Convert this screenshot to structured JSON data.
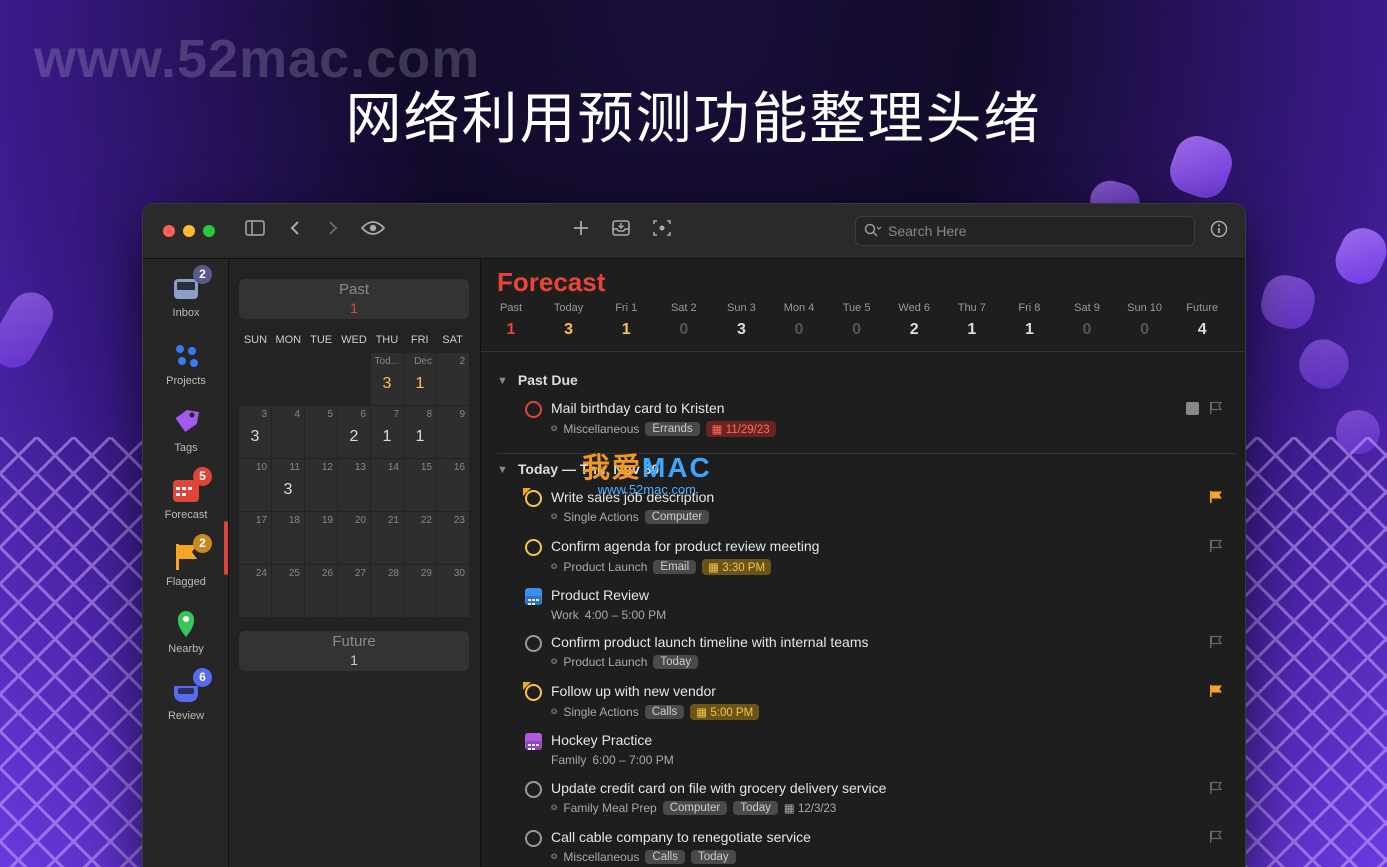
{
  "banner": {
    "watermark": "www.52mac.com",
    "headline": "网络利用预测功能整理头绪"
  },
  "watermark_center": {
    "cn": "我爱",
    "mac": "MAC",
    "url": "www.52mac.com"
  },
  "toolbar": {
    "search_placeholder": "Search Here"
  },
  "sidebar": {
    "items": [
      {
        "label": "Inbox",
        "badge": "2",
        "icon": "inbox-icon",
        "color": "#8aa0c8",
        "badge_color": "#5a5a8a"
      },
      {
        "label": "Projects",
        "badge": "",
        "icon": "projects-icon",
        "color": "#3a7bf5"
      },
      {
        "label": "Tags",
        "badge": "",
        "icon": "tag-icon",
        "color": "#a05af0"
      },
      {
        "label": "Forecast",
        "badge": "5",
        "icon": "forecast-icon",
        "color": "#e0453a",
        "badge_color": "#e0453a"
      },
      {
        "label": "Flagged",
        "badge": "2",
        "icon": "flag-icon",
        "color": "#f6a623",
        "badge_color": "#c88a20"
      },
      {
        "label": "Nearby",
        "badge": "",
        "icon": "location-pin-icon",
        "color": "#35c759"
      },
      {
        "label": "Review",
        "badge": "6",
        "icon": "review-icon",
        "color": "#5a6af0",
        "badge_color": "#5a6af0"
      }
    ]
  },
  "calendar": {
    "past_label": "Past",
    "past_count": "1",
    "future_label": "Future",
    "future_count": "1",
    "weekdays": [
      "SUN",
      "MON",
      "TUE",
      "WED",
      "THU",
      "FRI",
      "SAT"
    ],
    "rows": [
      [
        {
          "d": "",
          "c": ""
        },
        {
          "d": "",
          "c": ""
        },
        {
          "d": "",
          "c": ""
        },
        {
          "d": "",
          "c": ""
        },
        {
          "d": "Tod...",
          "c": "3",
          "hl": true
        },
        {
          "d": "Dec",
          "c": "1",
          "hl": true
        },
        {
          "d": "2",
          "c": ""
        }
      ],
      [
        {
          "d": "3",
          "c": "3"
        },
        {
          "d": "4",
          "c": ""
        },
        {
          "d": "5",
          "c": ""
        },
        {
          "d": "6",
          "c": "2"
        },
        {
          "d": "7",
          "c": "1"
        },
        {
          "d": "8",
          "c": "1"
        },
        {
          "d": "9",
          "c": ""
        }
      ],
      [
        {
          "d": "10",
          "c": ""
        },
        {
          "d": "11",
          "c": "3"
        },
        {
          "d": "12",
          "c": ""
        },
        {
          "d": "13",
          "c": ""
        },
        {
          "d": "14",
          "c": ""
        },
        {
          "d": "15",
          "c": ""
        },
        {
          "d": "16",
          "c": ""
        }
      ],
      [
        {
          "d": "17",
          "c": ""
        },
        {
          "d": "18",
          "c": ""
        },
        {
          "d": "19",
          "c": ""
        },
        {
          "d": "20",
          "c": ""
        },
        {
          "d": "21",
          "c": ""
        },
        {
          "d": "22",
          "c": ""
        },
        {
          "d": "23",
          "c": ""
        }
      ],
      [
        {
          "d": "24",
          "c": ""
        },
        {
          "d": "25",
          "c": ""
        },
        {
          "d": "26",
          "c": ""
        },
        {
          "d": "27",
          "c": ""
        },
        {
          "d": "28",
          "c": ""
        },
        {
          "d": "29",
          "c": ""
        },
        {
          "d": "30",
          "c": ""
        }
      ]
    ]
  },
  "forecast": {
    "title": "Forecast",
    "columns": [
      {
        "day": "Past",
        "count": "1",
        "color": "#e8453a"
      },
      {
        "day": "Today",
        "count": "3",
        "color": "#f6c54a"
      },
      {
        "day": "Fri 1",
        "count": "1",
        "color": "#f6c54a"
      },
      {
        "day": "Sat 2",
        "count": "0",
        "color": "#555"
      },
      {
        "day": "Sun 3",
        "count": "3",
        "color": "#ddd"
      },
      {
        "day": "Mon 4",
        "count": "0",
        "color": "#555"
      },
      {
        "day": "Tue 5",
        "count": "0",
        "color": "#555"
      },
      {
        "day": "Wed 6",
        "count": "2",
        "color": "#ddd"
      },
      {
        "day": "Thu 7",
        "count": "1",
        "color": "#ddd"
      },
      {
        "day": "Fri 8",
        "count": "1",
        "color": "#ddd"
      },
      {
        "day": "Sat 9",
        "count": "0",
        "color": "#555"
      },
      {
        "day": "Sun 10",
        "count": "0",
        "color": "#555"
      },
      {
        "day": "Future",
        "count": "4",
        "color": "#ddd"
      }
    ],
    "sections": {
      "past_due": "Past Due",
      "today": "Today — Thu, Nov 30"
    },
    "past_due_tasks": [
      {
        "title": "Mail birthday card to Kristen",
        "project": "Miscellaneous",
        "tags": [
          "Errands"
        ],
        "due": "11/29/23",
        "due_style": "red",
        "ring": "#e0453a",
        "flag": false,
        "note": true
      }
    ],
    "today_tasks": [
      {
        "kind": "task",
        "title": "Write sales job description",
        "project": "Single Actions",
        "tags": [
          "Computer"
        ],
        "due": "",
        "ring": "#f6c54a",
        "flag": true,
        "flag_corner": true
      },
      {
        "kind": "task",
        "title": "Confirm agenda for product review meeting",
        "project": "Product Launch",
        "tags": [
          "Email"
        ],
        "due": "3:30 PM",
        "due_style": "yel",
        "ring": "#f6c54a",
        "flag": false
      },
      {
        "kind": "event",
        "title": "Product Review",
        "project": "Work",
        "time": "4:00 – 5:00 PM",
        "cal_color": "#3a8ef5"
      },
      {
        "kind": "task",
        "title": "Confirm product launch timeline with internal teams",
        "project": "Product Launch",
        "tags": [
          "Today"
        ],
        "due": "",
        "ring": "#999",
        "flag": false
      },
      {
        "kind": "task",
        "title": "Follow up with new vendor",
        "project": "Single Actions",
        "tags": [
          "Calls"
        ],
        "due": "5:00 PM",
        "due_style": "yel",
        "ring": "#f6c54a",
        "flag": true,
        "flag_corner": true
      },
      {
        "kind": "event",
        "title": "Hockey Practice",
        "project": "Family",
        "time": "6:00 – 7:00 PM",
        "cal_color": "#b05ae0"
      },
      {
        "kind": "task",
        "title": "Update credit card on file with grocery delivery service",
        "project": "Family Meal Prep",
        "tags": [
          "Computer",
          "Today"
        ],
        "due": "12/3/23",
        "due_style": "plain",
        "ring": "#999",
        "flag": false
      },
      {
        "kind": "task",
        "title": "Call cable company to renegotiate service",
        "project": "Miscellaneous",
        "tags": [
          "Calls",
          "Today"
        ],
        "due": "",
        "ring": "#999",
        "flag": false
      }
    ]
  }
}
